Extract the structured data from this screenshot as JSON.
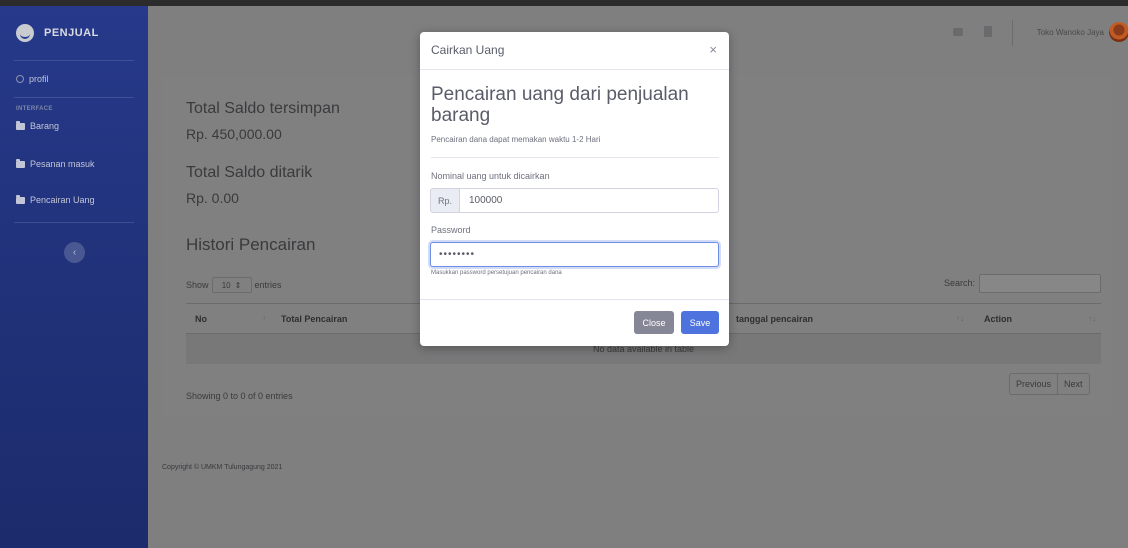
{
  "app": {
    "brand": "PENJUAL",
    "user_name": "Toko Wanoko Jaya"
  },
  "sidebar": {
    "profile": "profil",
    "heading": "INTERFACE",
    "items": [
      {
        "label": "Barang"
      },
      {
        "label": "Pesanan masuk"
      },
      {
        "label": "Pencairan Uang"
      }
    ],
    "toggle_icon": "‹"
  },
  "main": {
    "saldo_tersimpan_label": "Total Saldo tersimpan",
    "saldo_tersimpan_value": "Rp. 450,000.00",
    "saldo_ditarik_label": "Total Saldo ditarik",
    "saldo_ditarik_value": "Rp. 0.00",
    "histori_title": "Histori Pencairan",
    "show_label": "Show",
    "entries_label": "entries",
    "page_length": "10",
    "search_label": "Search:",
    "columns": [
      "No",
      "Total Pencairan",
      "tanggal pencairan",
      "Action"
    ],
    "empty_message": "No data available in table",
    "showing_text": "Showing 0 to 0 of 0 entries",
    "pager_prev": "Previous",
    "pager_next": "Next"
  },
  "footer": {
    "copyright": "Copyright © UMKM Tulungagung 2021"
  },
  "modal": {
    "title": "Cairkan Uang",
    "close_glyph": "×",
    "heading": "Pencairan uang dari penjualan barang",
    "subtitle": "Pencairan dana dapat memakan waktu 1-2 Hari",
    "amount_label": "Nominal uang untuk dicairkan",
    "currency_prefix": "Rp.",
    "amount_value": "100000",
    "password_label": "Password",
    "password_value": "••••••••",
    "password_help": "Masukkan password persetujuan pencairan dana",
    "close_button": "Close",
    "save_button": "Save"
  },
  "colors": {
    "sidebar": "#26398a",
    "primary": "#4e73df",
    "secondary": "#858796",
    "overlay": "#7f7f80"
  },
  "icons": {
    "brand": "smile-logo-icon",
    "sidebar_items": "folder-icon",
    "topbar": [
      "messages-icon",
      "notification-icon"
    ]
  }
}
